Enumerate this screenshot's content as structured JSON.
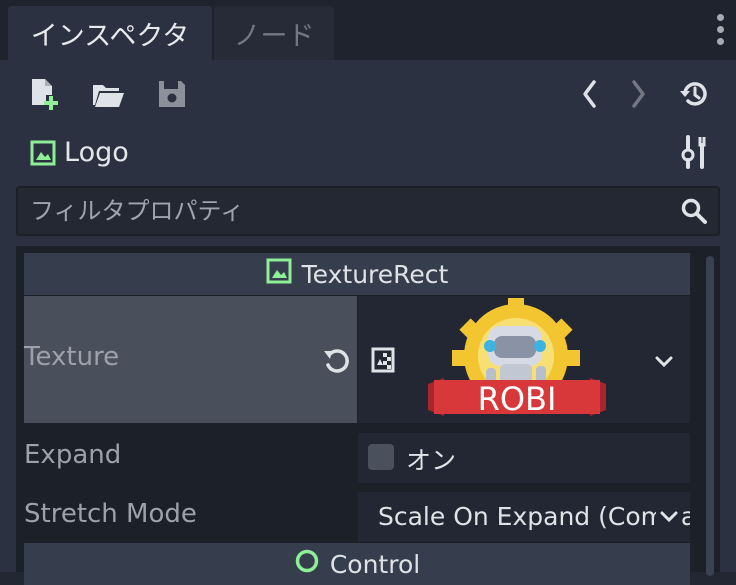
{
  "tabs": [
    {
      "label": "インスペクタ",
      "active": true
    },
    {
      "label": "ノード",
      "active": false
    }
  ],
  "toolbar": {
    "icons": [
      "new-resource-icon",
      "open-folder-icon",
      "save-icon",
      "back-icon",
      "forward-icon",
      "history-icon"
    ]
  },
  "node": {
    "name": "Logo",
    "icon": "texture-rect-icon",
    "settings_icon": "tools-icon"
  },
  "filter": {
    "placeholder": "フィルタプロパティ",
    "icon": "search-icon"
  },
  "sections": {
    "texture_rect": "TextureRect",
    "control": "Control"
  },
  "properties": {
    "texture": {
      "label": "Texture",
      "preview_text": "ROBI"
    },
    "expand": {
      "label": "Expand",
      "value_label": "オン",
      "checked": false
    },
    "stretch_mode": {
      "label": "Stretch Mode",
      "value": "Scale On Expand (Compatibility)"
    }
  },
  "colors": {
    "background": "#222733",
    "panel": "#2b3140",
    "section_header": "#363d4c",
    "accent_green": "#8eef97",
    "logo_red": "#d9383a",
    "logo_gold": "#f2c531"
  }
}
